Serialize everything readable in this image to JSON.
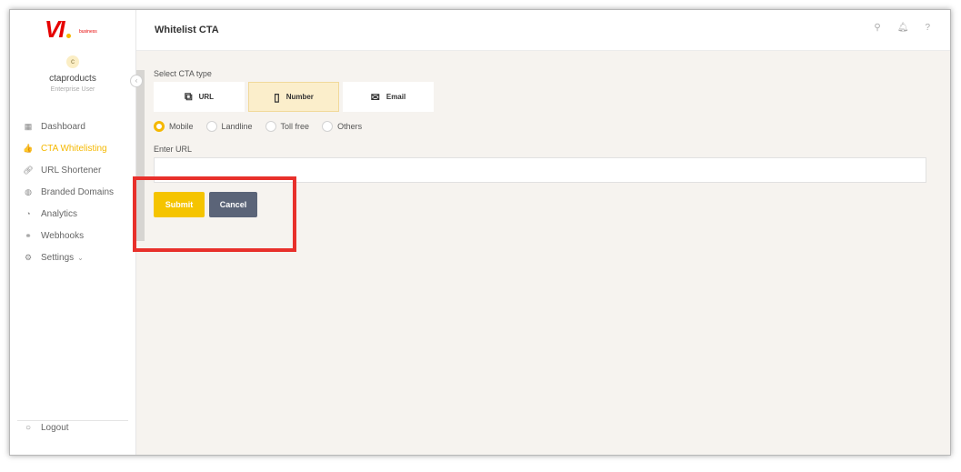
{
  "brand": {
    "logo_text": "VI",
    "logo_sub": "business"
  },
  "user": {
    "initial": "c",
    "name": "ctaproducts",
    "role": "Enterprise User"
  },
  "sidebar": {
    "items": [
      {
        "label": "Dashboard",
        "icon": "dashboard-icon"
      },
      {
        "label": "CTA Whitelisting",
        "icon": "thumbs-up-icon",
        "active": true
      },
      {
        "label": "URL Shortener",
        "icon": "link-icon"
      },
      {
        "label": "Branded Domains",
        "icon": "globe-icon"
      },
      {
        "label": "Analytics",
        "icon": "pie-chart-icon"
      },
      {
        "label": "Webhooks",
        "icon": "webhook-icon"
      },
      {
        "label": "Settings",
        "icon": "gear-icon",
        "has_dropdown": true
      }
    ],
    "logout_label": "Logout"
  },
  "header": {
    "title": "Whitelist CTA",
    "icons": [
      "search-icon",
      "bell-icon",
      "help-icon"
    ]
  },
  "form": {
    "select_cta_label": "Select CTA type",
    "cta_types": [
      {
        "label": "URL",
        "icon": "url-icon"
      },
      {
        "label": "Number",
        "icon": "phone-icon",
        "selected": true
      },
      {
        "label": "Email",
        "icon": "mail-icon"
      }
    ],
    "number_types": [
      {
        "label": "Mobile",
        "selected": true
      },
      {
        "label": "Landline"
      },
      {
        "label": "Toll free"
      },
      {
        "label": "Others"
      }
    ],
    "enter_url_label": "Enter URL",
    "url_value": "",
    "submit_label": "Submit",
    "cancel_label": "Cancel"
  },
  "colors": {
    "accent": "#f5c400",
    "cancel": "#5b6478",
    "highlight_box": "#e8302b",
    "content_bg": "#f6f3ef"
  }
}
